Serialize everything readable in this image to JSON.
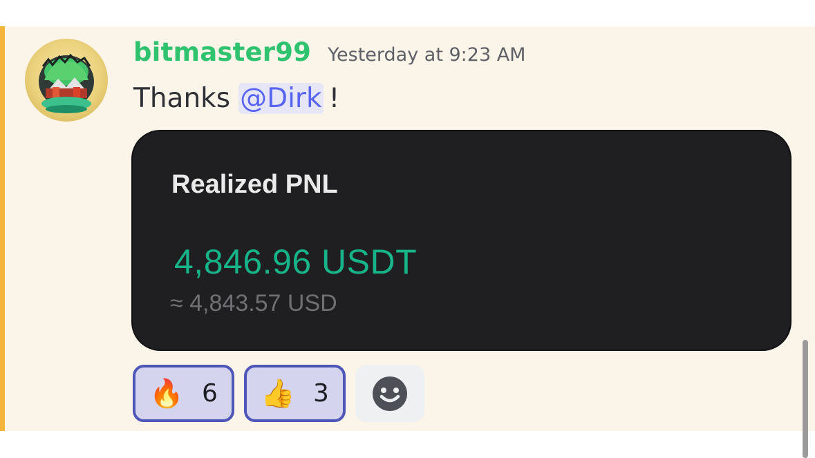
{
  "message": {
    "author": "bitmaster99",
    "timestamp": "Yesterday at 9:23 AM",
    "text_before": "Thanks",
    "mention": "@Dirk",
    "text_after": "!",
    "colors": {
      "highlight_bar": "#f2b53a",
      "username": "#2fc36f",
      "mention": "#5865f2",
      "background": "#fbf5e9"
    }
  },
  "attachment": {
    "title": "Realized PNL",
    "value": "4,846.96 USDT",
    "sub_value": "≈ 4,843.57 USD",
    "colors": {
      "background": "#1f1f21",
      "value": "#16b488"
    }
  },
  "reactions": [
    {
      "emoji": "🔥",
      "icon": "fire-icon",
      "count": "6"
    },
    {
      "emoji": "👍",
      "icon": "thumbs-up-icon",
      "count": "3"
    }
  ],
  "add_reaction": {
    "icon": "smiley-icon"
  }
}
